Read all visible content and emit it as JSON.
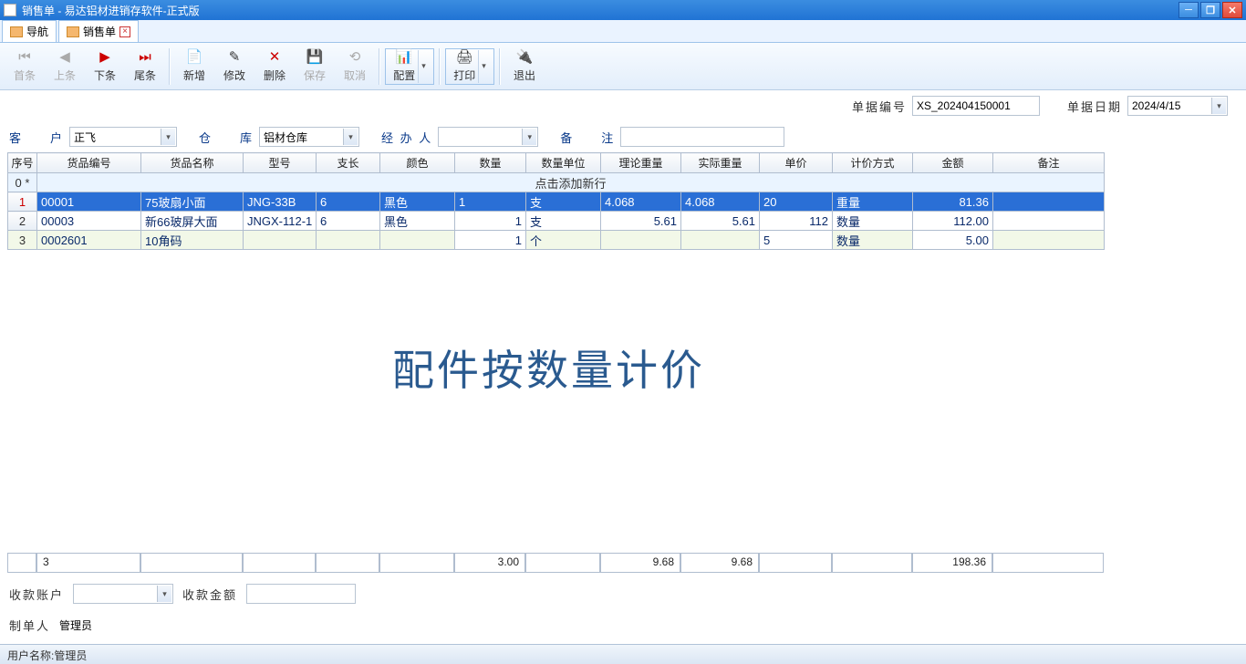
{
  "window": {
    "title": "销售单 - 易达铝材进销存软件-正式版"
  },
  "tabs": [
    {
      "label": "导航"
    },
    {
      "label": "销售单"
    }
  ],
  "toolbar": {
    "first": "首条",
    "prev": "上条",
    "next": "下条",
    "last": "尾条",
    "new": "新增",
    "edit": "修改",
    "del": "删除",
    "save": "保存",
    "cancel": "取消",
    "config": "配置",
    "print": "打印",
    "exit": "退出"
  },
  "header": {
    "doc_no_label": "单据编号",
    "doc_no": "XS_202404150001",
    "doc_date_label": "单据日期",
    "doc_date": "2024/4/15"
  },
  "form": {
    "customer_label": "客　　户",
    "customer": "正飞",
    "warehouse_label": "仓　　库",
    "warehouse": "铝材仓库",
    "handler_label": "经 办 人",
    "handler": "",
    "remark_label": "备　　注",
    "remark": ""
  },
  "columns": [
    "序号",
    "货品编号",
    "货品名称",
    "型号",
    "支长",
    "颜色",
    "数量",
    "数量单位",
    "理论重量",
    "实际重量",
    "单价",
    "计价方式",
    "金额",
    "备注"
  ],
  "addrow_hint": "点击添加新行",
  "rows": [
    {
      "no": "1",
      "code": "00001",
      "name": "75玻扇小面",
      "model": "JNG-33B",
      "len": "6",
      "color": "黑色",
      "qty": "1",
      "unit": "支",
      "tw": "4.068",
      "aw": "4.068",
      "price": "20",
      "mode": "重量",
      "amount": "81.36",
      "remark": ""
    },
    {
      "no": "2",
      "code": "00003",
      "name": "新66玻屏大面",
      "model": "JNGX-112-1",
      "len": "6",
      "color": "黑色",
      "qty": "1",
      "unit": "支",
      "tw": "5.61",
      "aw": "5.61",
      "price": "112",
      "mode": "数量",
      "amount": "112.00",
      "remark": ""
    },
    {
      "no": "3",
      "code": "0002601",
      "name": "10角码",
      "model": "",
      "len": "",
      "color": "",
      "qty": "1",
      "unit": "个",
      "tw": "",
      "aw": "",
      "price": "5",
      "mode": "数量",
      "amount": "5.00",
      "remark": ""
    }
  ],
  "totals": {
    "count": "3",
    "qty": "3.00",
    "tw": "9.68",
    "aw": "9.68",
    "amount": "198.36"
  },
  "footer": {
    "pay_acct_label": "收款账户",
    "pay_acct": "",
    "pay_amt_label": "收款金额",
    "pay_amt": "",
    "maker_label": "制单人",
    "maker": "管理员"
  },
  "status": {
    "user_label": "用户名称:",
    "user": "管理员"
  },
  "watermark": "配件按数量计价"
}
